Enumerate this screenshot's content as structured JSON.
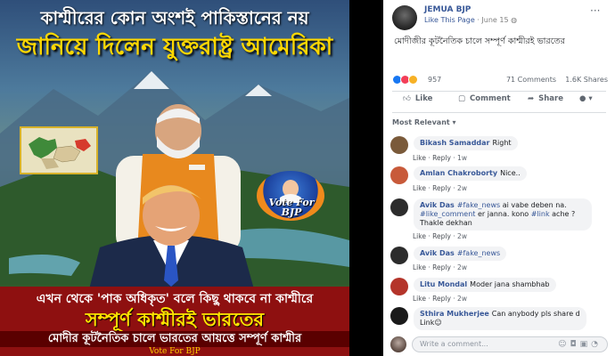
{
  "poster": {
    "headline_top": "কাশ্মীরের কোন অংশই পাকিস্তানের নয়",
    "headline_main": "জানিয়ে দিলেন যুক্তরাষ্ট্র আমেরিকা",
    "badge_line1": "Vote For",
    "badge_line2": "BJP",
    "band_line1": "এখন থেকে 'পাক অধিকৃত' বলে কিছু থাকবে না কাশ্মীরে",
    "band_line2": "সম্পূর্ণ কাশ্মীরই ভারতের",
    "band_line3": "মোদীর কূটনৈতিক চালে ভারতের আয়ত্তে সম্পূর্ণ কাশ্মীর",
    "band_footer": "Vote For BJP",
    "colors": {
      "headline_yellow": "#ffd800",
      "band_red": "#8e1010",
      "saffron": "#e8891e"
    }
  },
  "post": {
    "page_name": "JEMUA BJP",
    "like_page": "Like This Page",
    "date": "June 15",
    "privacy_icon": "globe-icon",
    "text": "মোদীজীর কূটনৈতিক চালে সম্পূর্ণ কাশ্মীরই ভারতের",
    "reaction_count": "957",
    "comments_count": "71 Comments",
    "shares_count": "1.6K Shares",
    "actions": {
      "like": "Like",
      "comment": "Comment",
      "share": "Share"
    },
    "sort_label": "Most Relevant"
  },
  "comments": [
    {
      "author": "Bikash Samaddar",
      "text": "Right",
      "tags": "",
      "text2": "",
      "time": "1w"
    },
    {
      "author": "Amlan Chakroborty",
      "text": "Nice..",
      "tags": "",
      "text2": "",
      "time": "2w"
    },
    {
      "author": "Avik Das",
      "tag1": "#fake_news",
      "text": "ai vabe deben na.",
      "tag2": "#like_comment",
      "text2": "er janna. kono",
      "tag3": "#link",
      "text3": "ache ?",
      "line3": "Thakle dekhan",
      "time": "2w"
    },
    {
      "author": "Avik Das",
      "tag1": "#fake_news",
      "time": "2w"
    },
    {
      "author": "Litu Mondal",
      "text": "Moder jana shambhab",
      "time": "2w"
    },
    {
      "author": "Sthira Mukherjee",
      "text": "Can anybody pls share d",
      "line2": "Link",
      "time": "2w"
    }
  ],
  "comment_actions": {
    "like": "Like",
    "reply": "Reply"
  },
  "write_comment": {
    "placeholder": "Write a comment..."
  }
}
